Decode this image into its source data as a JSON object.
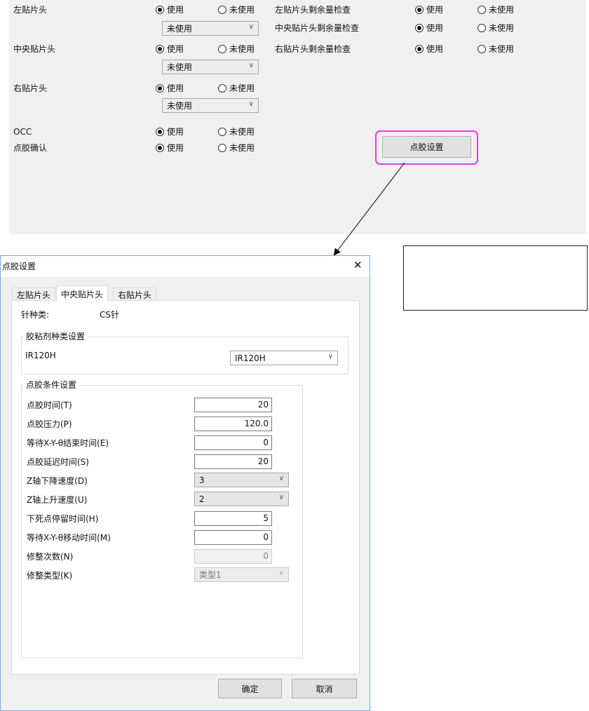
{
  "top_panel": {
    "rows": [
      {
        "label": "左贴片头",
        "use": "使用",
        "unuse": "未使用",
        "selected": "use",
        "dropdown": "未使用"
      },
      {
        "label": "中央贴片头",
        "use": "使用",
        "unuse": "未使用",
        "selected": "use",
        "dropdown": "未使用"
      },
      {
        "label": "右贴片头",
        "use": "使用",
        "unuse": "未使用",
        "selected": "use",
        "dropdown": "未使用"
      },
      {
        "label": "OCC",
        "use": "使用",
        "unuse": "未使用",
        "selected": "use"
      },
      {
        "label": "点胶确认",
        "use": "使用",
        "unuse": "未使用",
        "selected": "use"
      }
    ],
    "checks": [
      {
        "label": "左贴片头剩余量检查",
        "use": "使用",
        "unuse": "未使用",
        "selected": "use"
      },
      {
        "label": "中央贴片头剩余量检查",
        "use": "使用",
        "unuse": "未使用",
        "selected": "use"
      },
      {
        "label": "右贴片头剩余量检查",
        "use": "使用",
        "unuse": "未使用",
        "selected": "use"
      }
    ],
    "dispense_settings_button": "点胶设置"
  },
  "dialog": {
    "title": "点胶设置",
    "close_glyph": "✕",
    "tabs": [
      "左贴片头",
      "中央贴片头",
      "右贴片头"
    ],
    "active_tab": 1,
    "needle_type_label": "针种类:",
    "needle_type_value": "CS针",
    "adhesive_group": {
      "title": "胶粘剂种类设置",
      "current": "IR120H",
      "select_value": "IR120H"
    },
    "conditions_group": {
      "title": "点胶条件设置",
      "rows": [
        {
          "label": "点胶时间(T)",
          "value": "20",
          "kind": "number"
        },
        {
          "label": "点胶压力(P)",
          "value": "120.0",
          "kind": "number"
        },
        {
          "label": "等待X-Y-θ结束时间(E)",
          "value": "0",
          "kind": "number"
        },
        {
          "label": "点胶延迟时间(S)",
          "value": "20",
          "kind": "number"
        },
        {
          "label": "Z轴下降速度(D)",
          "value": "3",
          "kind": "select"
        },
        {
          "label": "Z轴上升速度(U)",
          "value": "2",
          "kind": "select"
        },
        {
          "label": "下死点停留时间(H)",
          "value": "5",
          "kind": "number"
        },
        {
          "label": "等待X-Y-θ移动时间(M)",
          "value": "0",
          "kind": "number"
        },
        {
          "label": "修整次数(N)",
          "value": "0",
          "kind": "number-disabled"
        },
        {
          "label": "修整类型(K)",
          "value": "类型1",
          "kind": "select-disabled"
        }
      ]
    },
    "ok_button": "确定",
    "cancel_button": "取消"
  },
  "colors": {
    "highlight": "#e63ce6",
    "panel": "#f0f0f0",
    "dialog_border": "#7aa7d8"
  }
}
